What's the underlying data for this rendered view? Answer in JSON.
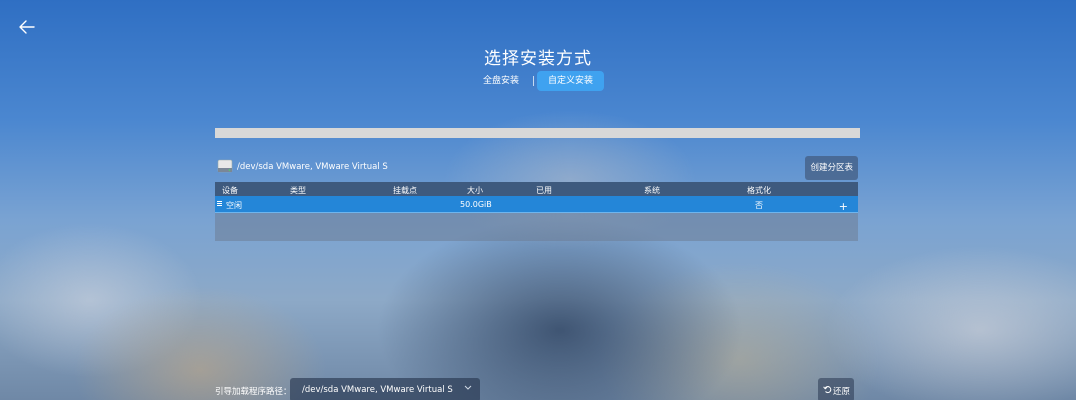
{
  "header": {
    "title": "选择安装方式",
    "back_icon": "arrow-left-icon"
  },
  "tabs": [
    {
      "label": "全盘安装",
      "active": false
    },
    {
      "label": "自定义安装",
      "active": true
    }
  ],
  "disk": {
    "name": "/dev/sda VMware, VMware Virtual S",
    "icon": "hard-disk-icon",
    "create_partition_label": "创建分区表"
  },
  "table": {
    "columns": [
      "设备",
      "类型",
      "挂载点",
      "大小",
      "已用",
      "系统",
      "格式化"
    ],
    "rows": [
      {
        "device": "空闲",
        "type": "",
        "mount": "",
        "size": "50.0GiB",
        "used": "",
        "system": "",
        "format": "否",
        "add": "+"
      }
    ]
  },
  "footer": {
    "boot_label": "引导加载程序路径：",
    "boot_value": "/dev/sda VMware, VMware Virtual S",
    "restore_label": "还原",
    "restore_icon": "undo-icon"
  },
  "colors": {
    "accent": "#3fa2f0",
    "row_selected": "#2486d8",
    "table_header": "#3e5a7e"
  }
}
